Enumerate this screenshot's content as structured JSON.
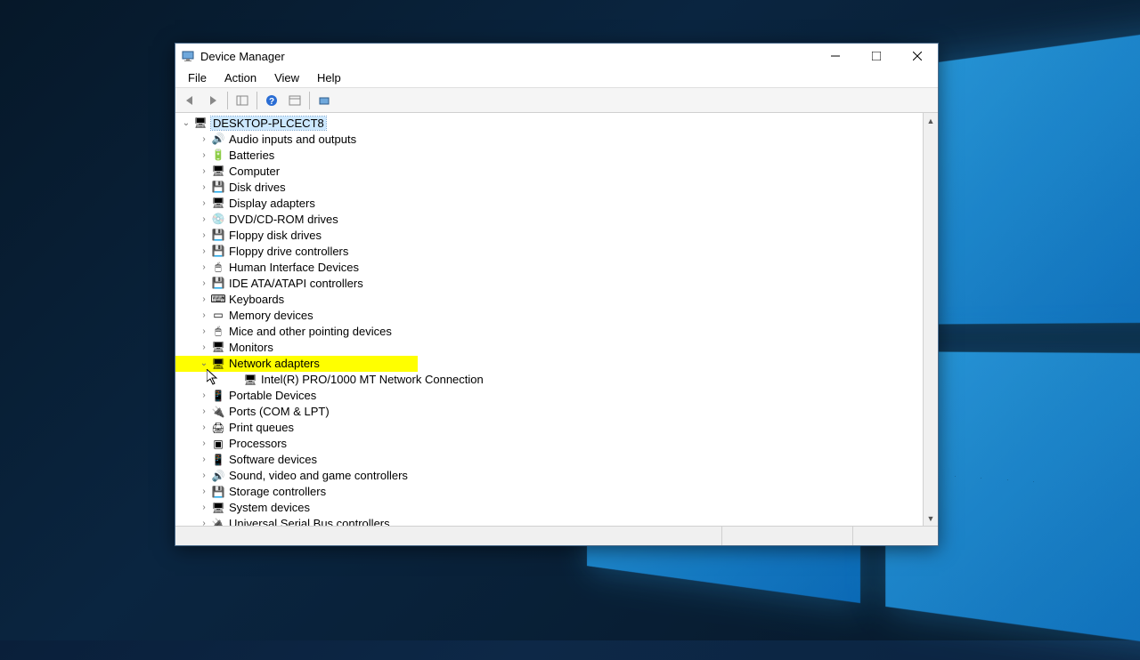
{
  "window": {
    "title": "Device Manager"
  },
  "menubar": {
    "items": [
      "File",
      "Action",
      "View",
      "Help"
    ]
  },
  "tree": {
    "root_label": "DESKTOP-PLCECT8",
    "categories": [
      {
        "label": "Audio inputs and outputs",
        "icon": "audio-icon",
        "glyph": "🔊",
        "expanded": false
      },
      {
        "label": "Batteries",
        "icon": "battery-icon",
        "glyph": "🔋",
        "expanded": false
      },
      {
        "label": "Computer",
        "icon": "computer-icon",
        "glyph": "🖥",
        "expanded": false
      },
      {
        "label": "Disk drives",
        "icon": "disk-icon",
        "glyph": "💾",
        "expanded": false
      },
      {
        "label": "Display adapters",
        "icon": "display-icon",
        "glyph": "🖥",
        "expanded": false
      },
      {
        "label": "DVD/CD-ROM drives",
        "icon": "dvd-icon",
        "glyph": "💿",
        "expanded": false
      },
      {
        "label": "Floppy disk drives",
        "icon": "floppy-icon",
        "glyph": "💾",
        "expanded": false
      },
      {
        "label": "Floppy drive controllers",
        "icon": "controller-icon",
        "glyph": "💾",
        "expanded": false
      },
      {
        "label": "Human Interface Devices",
        "icon": "hid-icon",
        "glyph": "🖱",
        "expanded": false
      },
      {
        "label": "IDE ATA/ATAPI controllers",
        "icon": "ide-icon",
        "glyph": "💾",
        "expanded": false
      },
      {
        "label": "Keyboards",
        "icon": "keyboard-icon",
        "glyph": "⌨",
        "expanded": false
      },
      {
        "label": "Memory devices",
        "icon": "memory-icon",
        "glyph": "▭",
        "expanded": false
      },
      {
        "label": "Mice and other pointing devices",
        "icon": "mouse-icon",
        "glyph": "🖱",
        "expanded": false
      },
      {
        "label": "Monitors",
        "icon": "monitor-icon",
        "glyph": "🖥",
        "expanded": false
      },
      {
        "label": "Network adapters",
        "icon": "network-icon",
        "glyph": "🖥",
        "expanded": true,
        "highlighted": true,
        "children": [
          {
            "label": "Intel(R) PRO/1000 MT Network Connection",
            "icon": "nic-icon",
            "glyph": "🖥"
          }
        ]
      },
      {
        "label": "Portable Devices",
        "icon": "portable-icon",
        "glyph": "📱",
        "expanded": false
      },
      {
        "label": "Ports (COM & LPT)",
        "icon": "port-icon",
        "glyph": "🔌",
        "expanded": false
      },
      {
        "label": "Print queues",
        "icon": "printer-icon",
        "glyph": "🖨",
        "expanded": false
      },
      {
        "label": "Processors",
        "icon": "cpu-icon",
        "glyph": "▣",
        "expanded": false
      },
      {
        "label": "Software devices",
        "icon": "software-icon",
        "glyph": "📱",
        "expanded": false
      },
      {
        "label": "Sound, video and game controllers",
        "icon": "sound-icon",
        "glyph": "🔊",
        "expanded": false
      },
      {
        "label": "Storage controllers",
        "icon": "storage-icon",
        "glyph": "💾",
        "expanded": false
      },
      {
        "label": "System devices",
        "icon": "system-icon",
        "glyph": "🖥",
        "expanded": false
      },
      {
        "label": "Universal Serial Bus controllers",
        "icon": "usb-icon",
        "glyph": "🔌",
        "expanded": false
      }
    ]
  }
}
